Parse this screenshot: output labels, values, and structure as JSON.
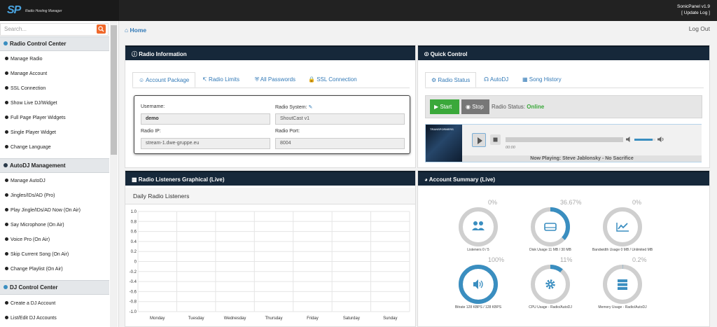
{
  "app": {
    "logo": "SP",
    "subtitle": "Radio Hosting Manager",
    "version": "SonicPanel v1.9",
    "update": "[ Update Log ]"
  },
  "search": {
    "placeholder": "Search..."
  },
  "sidebar": {
    "sections": [
      {
        "title": "Radio Control Center",
        "items": [
          "Manage Radio",
          "Manage Account",
          "SSL Connection",
          "Show Live DJ/Widget",
          "Full Page Player Widgets",
          "Single Player Widget",
          "Change Language"
        ]
      },
      {
        "title": "AutoDJ Management",
        "items": [
          "Manage AutoDJ",
          "Jingles/IDs/AD (Pro)",
          "Play Jingle/IDs/AD Now (On Air)",
          "Say Microphone (On Air)",
          "Voice Pro (On Air)",
          "Skip Current Song (On Air)",
          "Change Playlist (On Air)"
        ]
      },
      {
        "title": "DJ Control Center",
        "items": [
          "Create a DJ Account",
          "List/Edit DJ Accounts"
        ]
      }
    ]
  },
  "breadcrumb": {
    "home": "Home"
  },
  "header": {
    "logout": "Log Out"
  },
  "radio_info": {
    "title": "Radio Information",
    "tabs": [
      "Account Package",
      "Radio Limits",
      "All Passwords",
      "SSL Connection"
    ],
    "fields": {
      "username_label": "Username:",
      "username": "demo",
      "system_label": "Radio System:",
      "system": "ShoutCast v1",
      "ip_label": "Radio IP:",
      "ip": "stream-1.dwe-gruppe.eu",
      "port_label": "Radio Port:",
      "port": "8004"
    }
  },
  "quick": {
    "title": "Quick Control",
    "tabs": [
      "Radio Status",
      "AutoDJ",
      "Song History"
    ],
    "start": "Start",
    "stop": "Stop",
    "status_label": "Radio Status:",
    "status": "Online",
    "album_text": "TRANSFORMERS",
    "time": "00:00",
    "now_playing": "Now Playing: Steve Jablonsky - No Sacrifice",
    "seek_progress": 0,
    "volume_level": 0.85
  },
  "listeners": {
    "title": "Radio Listeners Graphical (Live)",
    "subtitle": "Daily Radio Listeners"
  },
  "chart_data": {
    "type": "line",
    "title": "Daily Radio Listeners",
    "categories": [
      "Monday",
      "Tuesday",
      "Wednesday",
      "Thursday",
      "Friday",
      "Saturday",
      "Sunday"
    ],
    "series": [],
    "ylim": [
      -1.0,
      1.0
    ],
    "yticks": [
      "1.0",
      "0.8",
      "0.6",
      "0.4",
      "0.2",
      "0",
      "-0.2",
      "-0.4",
      "-0.6",
      "-0.8",
      "-1.0"
    ],
    "grid": true
  },
  "summary": {
    "title": "Account Summary (Live)",
    "items": [
      {
        "pct": "0%",
        "value": 0,
        "label": "Listeners 0 / 5",
        "icon": "users-icon"
      },
      {
        "pct": "36.67%",
        "value": 36.67,
        "label": "Disk Usage 11 MB / 30 MB",
        "icon": "hdd-icon"
      },
      {
        "pct": "0%",
        "value": 0,
        "label": "Bandwidth Usage 0 MB / Unlimited MB",
        "icon": "chart-icon"
      },
      {
        "pct": "100%",
        "value": 100,
        "label": "Bitrate 128 KBPS / 128 KBPS",
        "icon": "volume-icon"
      },
      {
        "pct": "11%",
        "value": 11,
        "label": "CPU Usage - Radio/AutoDJ",
        "icon": "gear-icon"
      },
      {
        "pct": "0.2%",
        "value": 0.2,
        "label": "Memory Usage - Radio/AutoDJ",
        "icon": "server-icon"
      }
    ]
  },
  "colors": {
    "header": "#16283a",
    "accent": "#3a8ec0",
    "start": "#3aa83a",
    "stop": "#777777",
    "online": "#3aa83a"
  }
}
